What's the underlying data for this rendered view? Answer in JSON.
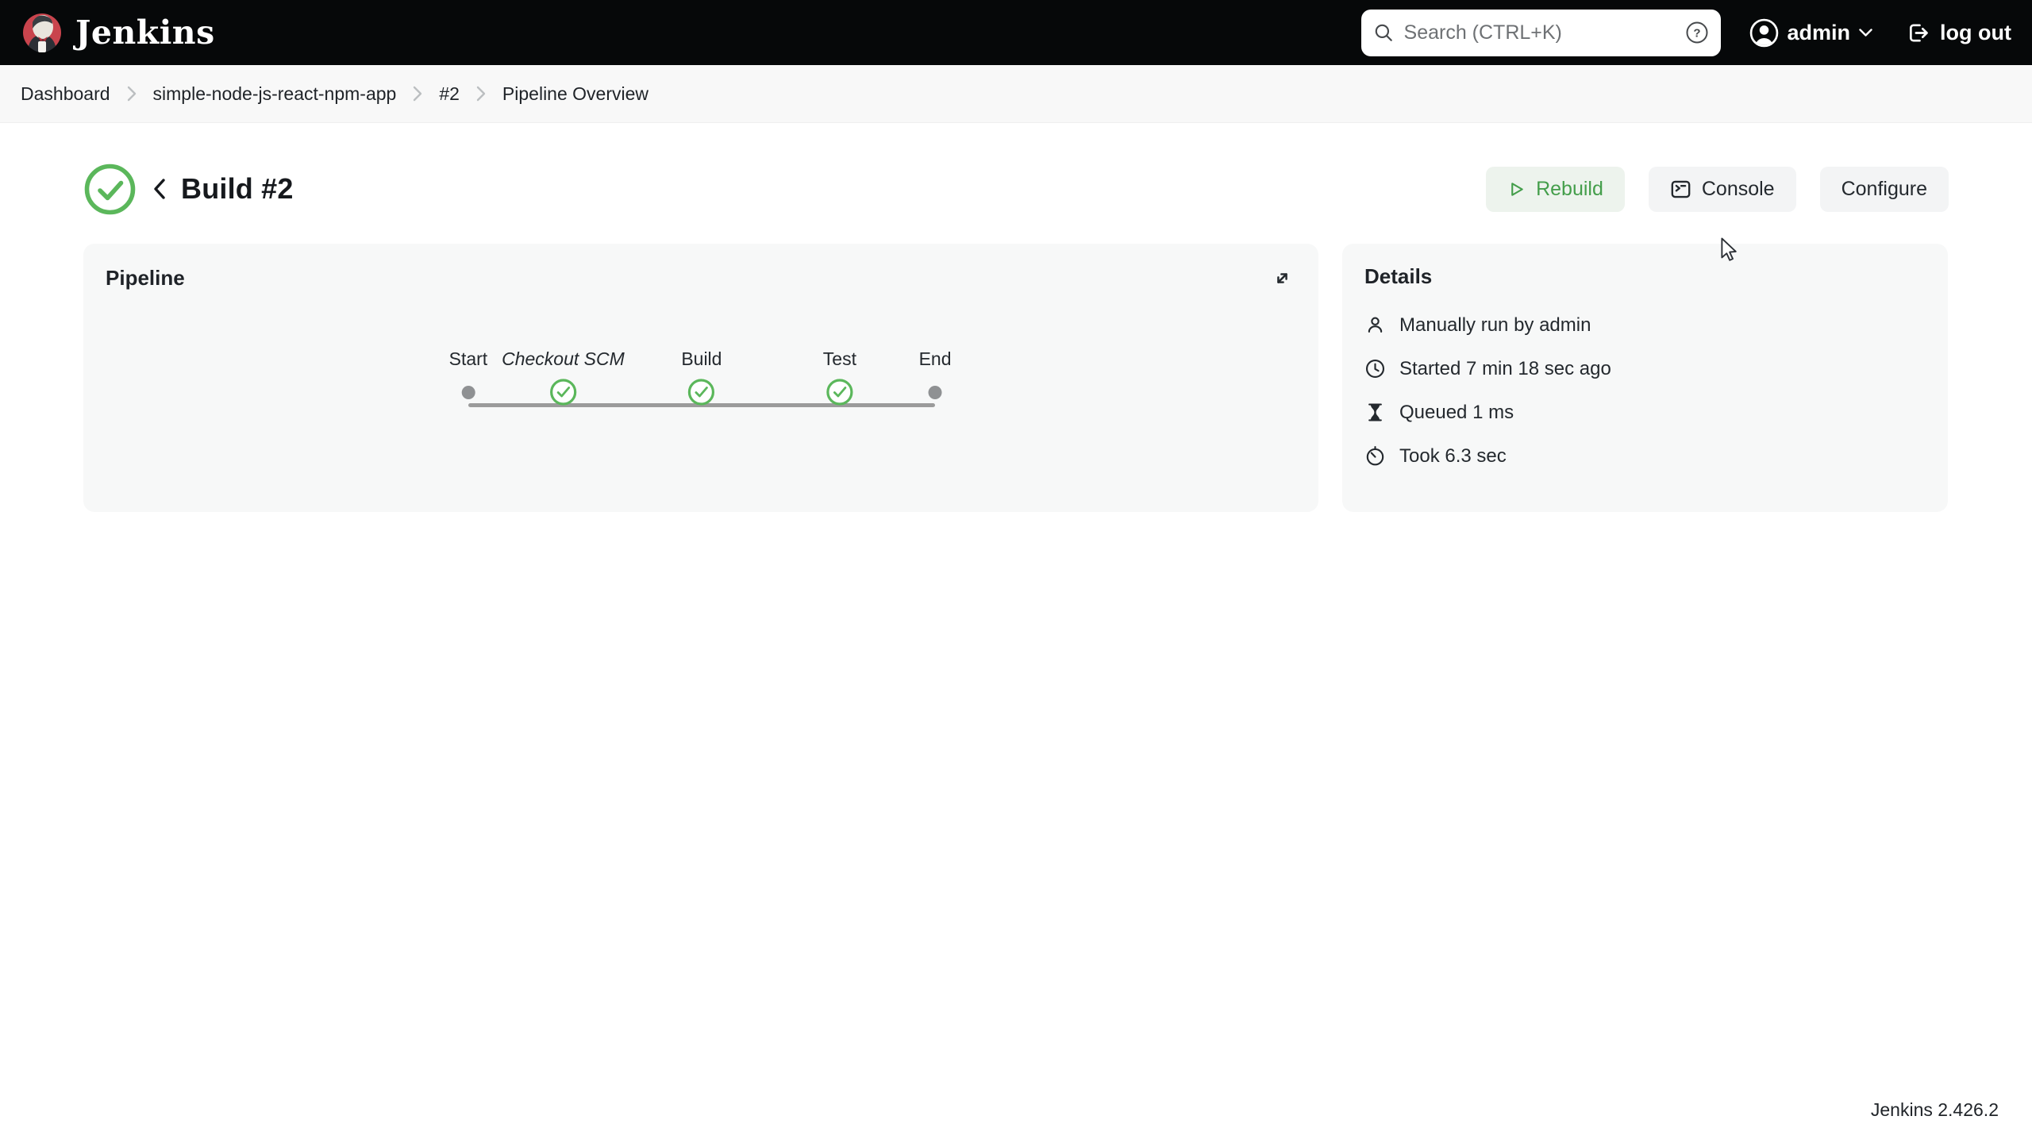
{
  "navbar": {
    "brand": "Jenkins",
    "search": {
      "placeholder": "Search (CTRL+K)"
    },
    "user": "admin",
    "logout_label": "log out"
  },
  "breadcrumb": [
    "Dashboard",
    "simple-node-js-react-npm-app",
    "#2",
    "Pipeline Overview"
  ],
  "page": {
    "title": "Build #2",
    "status": "success",
    "actions": {
      "rebuild": "Rebuild",
      "console": "Console",
      "configure": "Configure"
    }
  },
  "pipeline": {
    "title": "Pipeline",
    "stages": [
      {
        "label": "Start",
        "type": "terminal"
      },
      {
        "label": "Checkout SCM",
        "type": "success"
      },
      {
        "label": "Build",
        "type": "success"
      },
      {
        "label": "Test",
        "type": "success"
      },
      {
        "label": "End",
        "type": "terminal"
      }
    ]
  },
  "details": {
    "title": "Details",
    "rows": [
      {
        "icon": "user-icon",
        "text": "Manually run by admin"
      },
      {
        "icon": "clock-icon",
        "text": "Started 7 min 18 sec ago"
      },
      {
        "icon": "hourglass-icon",
        "text": "Queued 1 ms"
      },
      {
        "icon": "stopwatch-icon",
        "text": "Took 6.3 sec"
      }
    ]
  },
  "footer": {
    "version": "Jenkins 2.426.2"
  },
  "colors": {
    "navbar_bg": "#060809",
    "success_green": "#5bb75b",
    "rebuild_green": "#449e4b",
    "card_bg": "#f7f8f8",
    "line_gray": "#9b9b9b"
  }
}
